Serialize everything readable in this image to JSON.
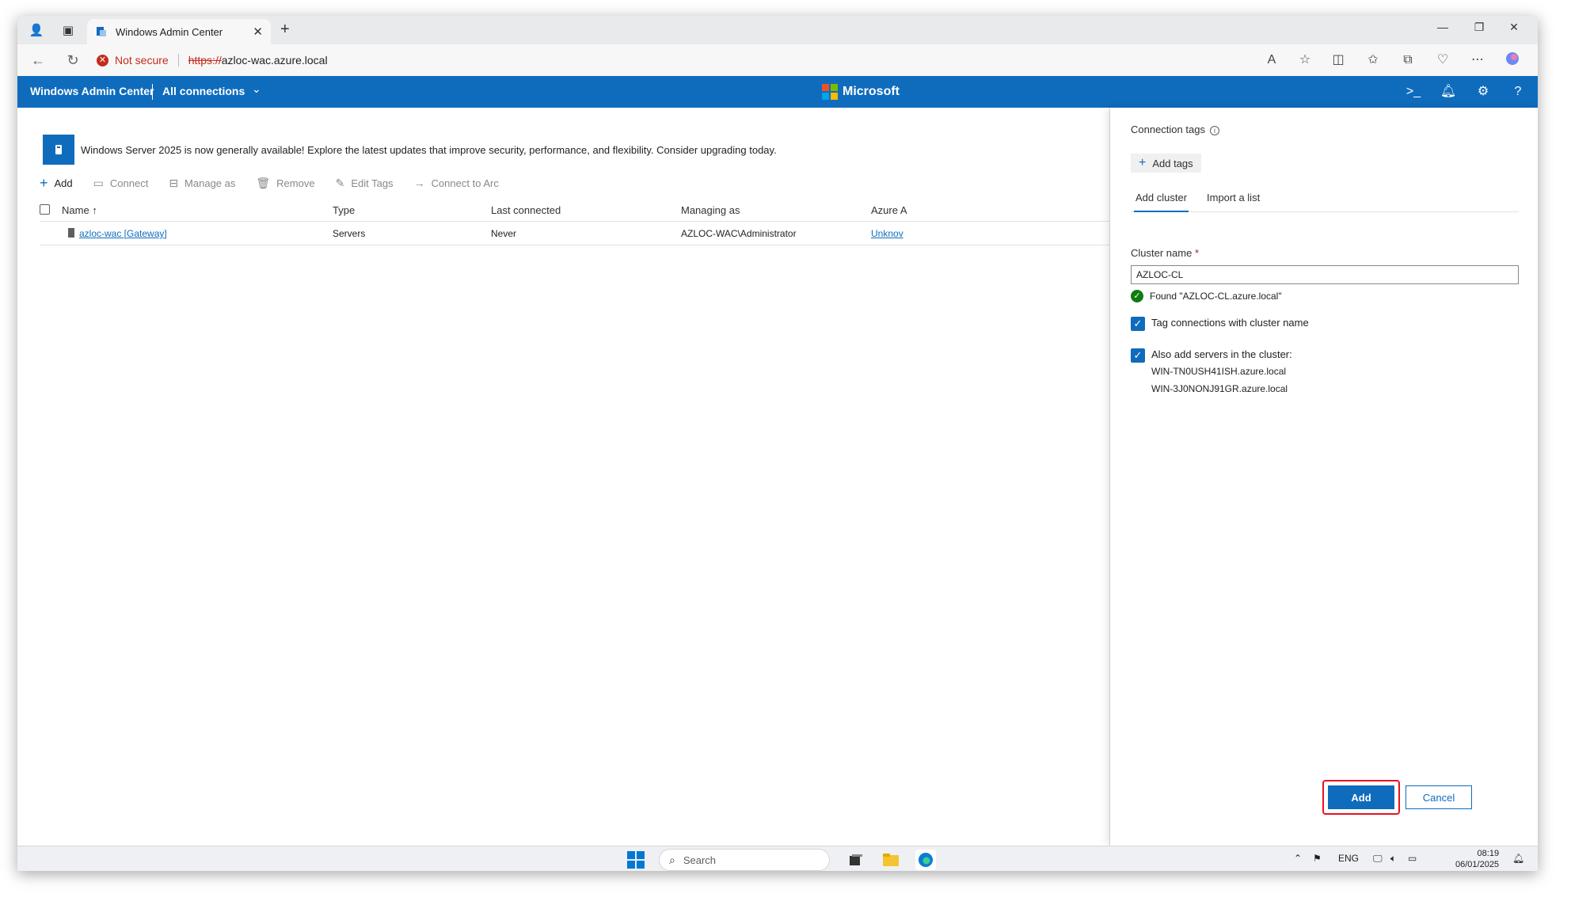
{
  "browser": {
    "tab_title": "Windows Admin Center",
    "security_label": "Not secure",
    "url_scheme": "https://",
    "url_host": "azloc-wac.azure.local"
  },
  "header": {
    "brand": "Windows Admin Center",
    "connections_menu": "All connections",
    "center_logo_text": "Microsoft"
  },
  "banner": {
    "text": "Windows Server 2025 is now generally available! Explore the latest updates that improve security, performance, and flexibility. Consider upgrading today."
  },
  "toolbar": {
    "add": "Add",
    "connect": "Connect",
    "manage_as": "Manage as",
    "remove": "Remove",
    "edit_tags": "Edit Tags",
    "connect_to_arc": "Connect to Arc"
  },
  "grid": {
    "columns": [
      "Name",
      "Type",
      "Last connected",
      "Managing as",
      "Azure A"
    ],
    "rows": [
      {
        "name": "azloc-wac [Gateway]",
        "type": "Servers",
        "last_connected": "Never",
        "managing_as": "AZLOC-WAC\\Administrator",
        "azure": "Unknov"
      }
    ]
  },
  "panel": {
    "connection_tags_label": "Connection tags",
    "add_tags": "Add tags",
    "tabs": [
      "Add cluster",
      "Import a list"
    ],
    "cluster_name_label": "Cluster name",
    "required_marker": "*",
    "cluster_name_value": "AZLOC-CL",
    "found_message": "Found \"AZLOC-CL.azure.local\"",
    "tag_checkbox_label": "Tag connections with cluster name",
    "also_add_label": "Also add servers in the cluster:",
    "servers": [
      "WIN-TN0USH41ISH.azure.local",
      "WIN-3J0NONJ91GR.azure.local"
    ],
    "add_button": "Add",
    "cancel_button": "Cancel"
  },
  "taskbar": {
    "search_placeholder": "Search",
    "language": "ENG",
    "time": "08:19",
    "date": "06/01/2025"
  },
  "colors": {
    "accent": "#0f6cbd",
    "error": "#c42b1c",
    "success": "#107c10",
    "highlight": "#e81123"
  }
}
